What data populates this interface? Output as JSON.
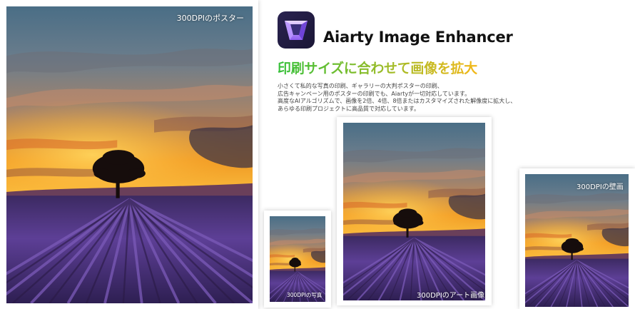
{
  "app": {
    "name": "Aiarty Image Enhancer",
    "logo_icon": "aiarty-logo-icon"
  },
  "headline": {
    "text": "印刷サイズに合わせて画像を拡大",
    "color_start": "#36c03a",
    "color_end": "#f3b81a"
  },
  "description": {
    "lines": [
      "小さくて私的な写真の印刷、ギャラリーの大判ポスターの印刷、",
      "広告キャンペーン用のポスターの印刷でも、Aiartyが一切対応しています。",
      "高度なAIアルゴリズムで、画像を2倍、4倍、8倍またはカスタマイズされた解像度に拡大し、",
      "あらゆる印刷プロジェクトに高品質で対応しています。"
    ]
  },
  "prints": {
    "poster": {
      "label": "300DPIのポスター"
    },
    "photo": {
      "label": "300DPIの写真"
    },
    "art": {
      "label": "300DPIのアート画像"
    },
    "mural": {
      "label": "300DPIの壁画"
    }
  },
  "colors": {
    "sky_top": "#4a6e86",
    "sunset_orange": "#f09a24",
    "sun_glow": "#ffd35a",
    "lavender": "#5d3f96",
    "tree": "#160d0c"
  }
}
